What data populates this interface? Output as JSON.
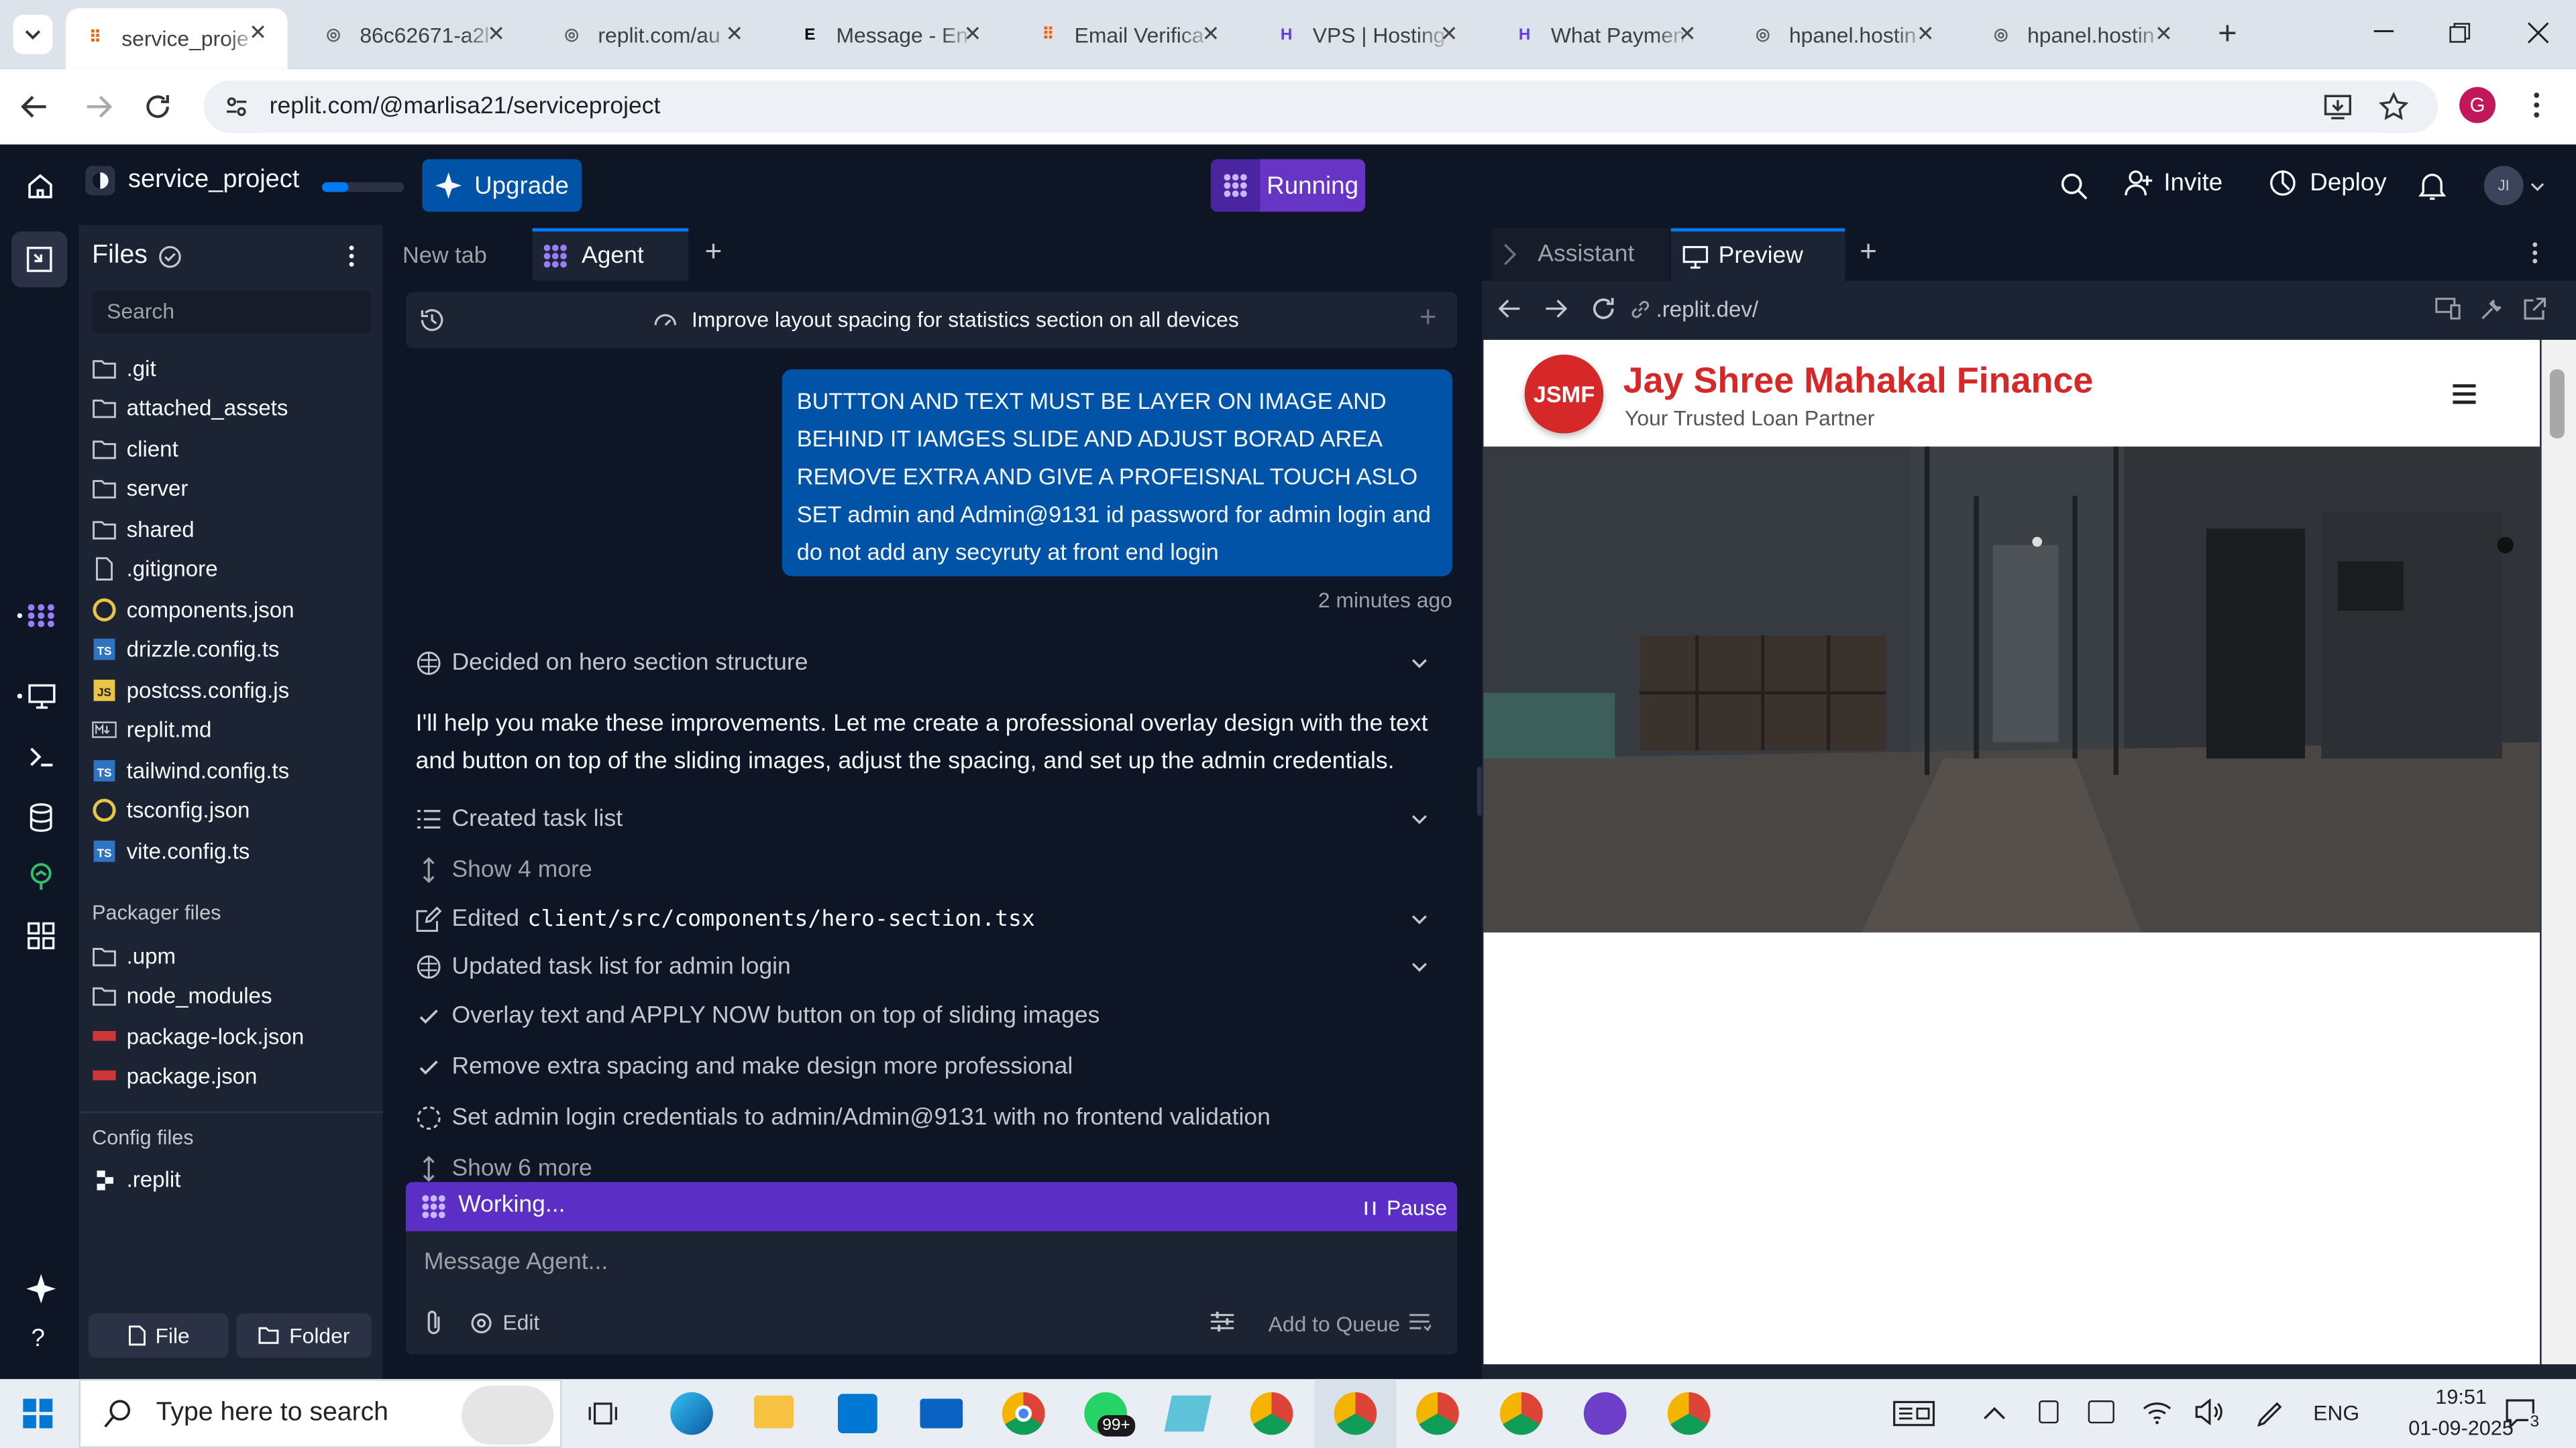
{
  "browser": {
    "tabs": [
      {
        "title": "service_proje",
        "color": "#f26207",
        "glyph": "⠿"
      },
      {
        "title": "86c62671-a2l",
        "color": "#5f6368",
        "glyph": "◎"
      },
      {
        "title": "replit.com/au",
        "color": "#5f6368",
        "glyph": "◎"
      },
      {
        "title": "Message - En",
        "color": "#000000",
        "glyph": "E"
      },
      {
        "title": "Email Verifica",
        "color": "#f26207",
        "glyph": "⠿"
      },
      {
        "title": "VPS | Hosting",
        "color": "#673de6",
        "glyph": "H"
      },
      {
        "title": "What Paymen",
        "color": "#673de6",
        "glyph": "H"
      },
      {
        "title": "hpanel.hostin",
        "color": "#5f6368",
        "glyph": "◎"
      },
      {
        "title": "hpanel.hostin",
        "color": "#5f6368",
        "glyph": "◎"
      }
    ],
    "url": "replit.com/@marlisa21/serviceproject",
    "profile_initial": "G"
  },
  "app": {
    "project_name": "service_project",
    "upgrade_label": "Upgrade",
    "running_label": "Running",
    "invite_label": "Invite",
    "deploy_label": "Deploy",
    "user_initials": "JI"
  },
  "files": {
    "title": "Files",
    "search_placeholder": "Search",
    "items": [
      {
        "name": ".git",
        "type": "folder"
      },
      {
        "name": "attached_assets",
        "type": "folder"
      },
      {
        "name": "client",
        "type": "folder"
      },
      {
        "name": "server",
        "type": "folder"
      },
      {
        "name": "shared",
        "type": "folder"
      },
      {
        "name": ".gitignore",
        "type": "file"
      },
      {
        "name": "components.json",
        "type": "json"
      },
      {
        "name": "drizzle.config.ts",
        "type": "ts"
      },
      {
        "name": "postcss.config.js",
        "type": "js"
      },
      {
        "name": "replit.md",
        "type": "md"
      },
      {
        "name": "tailwind.config.ts",
        "type": "ts"
      },
      {
        "name": "tsconfig.json",
        "type": "json"
      },
      {
        "name": "vite.config.ts",
        "type": "ts"
      }
    ],
    "packager_title": "Packager files",
    "packager_items": [
      {
        "name": ".upm",
        "type": "folder"
      },
      {
        "name": "node_modules",
        "type": "folder"
      },
      {
        "name": "package-lock.json",
        "type": "npm"
      },
      {
        "name": "package.json",
        "type": "npm"
      }
    ],
    "config_title": "Config files",
    "config_items": [
      {
        "name": ".replit",
        "type": "replit"
      }
    ],
    "file_button": "File",
    "folder_button": "Folder"
  },
  "agent": {
    "tab_new": "New tab",
    "tab_agent": "Agent",
    "thread_title": "Improve layout spacing for statistics section on all devices",
    "user_message": "BUTTTON AND TEXT MUST BE LAYER ON IMAGE AND BEHIND IT IAMGES SLIDE AND ADJUST BORAD AREA REMOVE EXTRA AND GIVE A PROFEISNAL TOUCH ASLO SET admin and Admin@9131 id password for admin login and do not add any secyruty at front end login",
    "timestamp": "2 minutes ago",
    "decided": "Decided on hero section structure",
    "reply": "I'll help you make these improvements. Let me create a professional overlay design with the text and button on top of the sliding images, adjust the spacing, and set up the admin credentials.",
    "created_task": "Created task list",
    "show_more_1": "Show 4 more",
    "edited_prefix": "Edited",
    "edited_file": "client/src/components/hero-section.tsx",
    "updated_task": "Updated task list for admin login",
    "tasks": [
      {
        "text": "Overlay text and APPLY NOW button on top of sliding images",
        "done": true
      },
      {
        "text": "Remove extra spacing and make design more professional",
        "done": true
      },
      {
        "text": "Set admin login credentials to admin/Admin@9131 with no frontend validation",
        "done": false
      }
    ],
    "show_more_2": "Show 6 more",
    "working": "Working...",
    "pause": "Pause",
    "input_placeholder": "Message Agent...",
    "edit_label": "Edit",
    "queue_label": "Add to Queue"
  },
  "preview": {
    "tab_assistant": "Assistant",
    "tab_preview": "Preview",
    "url": ".replit.dev/",
    "logo_text": "JSMF",
    "site_title": "Jay Shree Mahakal Finance",
    "site_tagline": "Your Trusted Loan Partner",
    "brand_color": "#d62828"
  },
  "taskbar": {
    "search_placeholder": "Type here to search",
    "whatsapp_badge": "99+",
    "lang": "ENG",
    "time": "19:51",
    "date": "01-09-2025",
    "notif_count": "3"
  }
}
